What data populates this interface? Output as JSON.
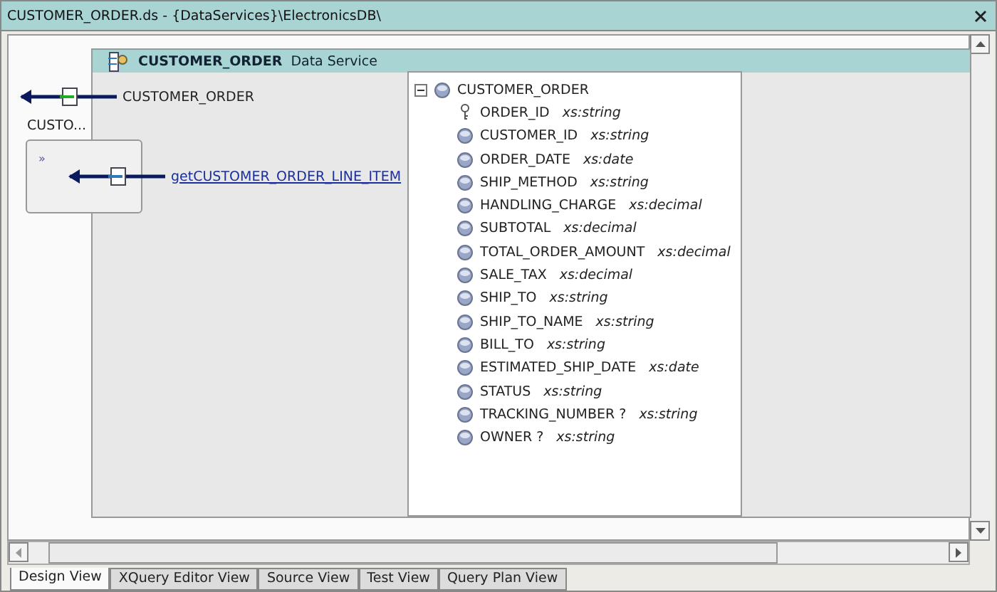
{
  "window": {
    "title": "CUSTOMER_ORDER.ds - {DataServices}\\ElectronicsDB\\"
  },
  "service": {
    "name": "CUSTOMER_ORDER",
    "label": "Data Service"
  },
  "return_node": {
    "label": "CUSTOMER_ORDER"
  },
  "function_node": {
    "title": "CUSTO...",
    "mark": "»",
    "link": "getCUSTOMER_ORDER_LINE_ITEM"
  },
  "tree": {
    "root": "CUSTOMER_ORDER",
    "expanded": true,
    "fields": [
      {
        "name": "ORDER_ID",
        "type": "xs:string",
        "kind": "key"
      },
      {
        "name": "CUSTOMER_ID",
        "type": "xs:string",
        "kind": "element"
      },
      {
        "name": "ORDER_DATE",
        "type": "xs:date",
        "kind": "element"
      },
      {
        "name": "SHIP_METHOD",
        "type": "xs:string",
        "kind": "element"
      },
      {
        "name": "HANDLING_CHARGE",
        "type": "xs:decimal",
        "kind": "element"
      },
      {
        "name": "SUBTOTAL",
        "type": "xs:decimal",
        "kind": "element"
      },
      {
        "name": "TOTAL_ORDER_AMOUNT",
        "type": "xs:decimal",
        "kind": "element"
      },
      {
        "name": "SALE_TAX",
        "type": "xs:decimal",
        "kind": "element"
      },
      {
        "name": "SHIP_TO",
        "type": "xs:string",
        "kind": "element"
      },
      {
        "name": "SHIP_TO_NAME",
        "type": "xs:string",
        "kind": "element"
      },
      {
        "name": "BILL_TO",
        "type": "xs:string",
        "kind": "element"
      },
      {
        "name": "ESTIMATED_SHIP_DATE",
        "type": "xs:date",
        "kind": "element"
      },
      {
        "name": "STATUS",
        "type": "xs:string",
        "kind": "element"
      },
      {
        "name": "TRACKING_NUMBER ?",
        "type": "xs:string",
        "kind": "element"
      },
      {
        "name": "OWNER ?",
        "type": "xs:string",
        "kind": "element"
      }
    ]
  },
  "tabs": [
    {
      "label": "Design View",
      "selected": true
    },
    {
      "label": "XQuery Editor View",
      "selected": false
    },
    {
      "label": "Source View",
      "selected": false
    },
    {
      "label": "Test View",
      "selected": false
    },
    {
      "label": "Query Plan View",
      "selected": false
    }
  ]
}
